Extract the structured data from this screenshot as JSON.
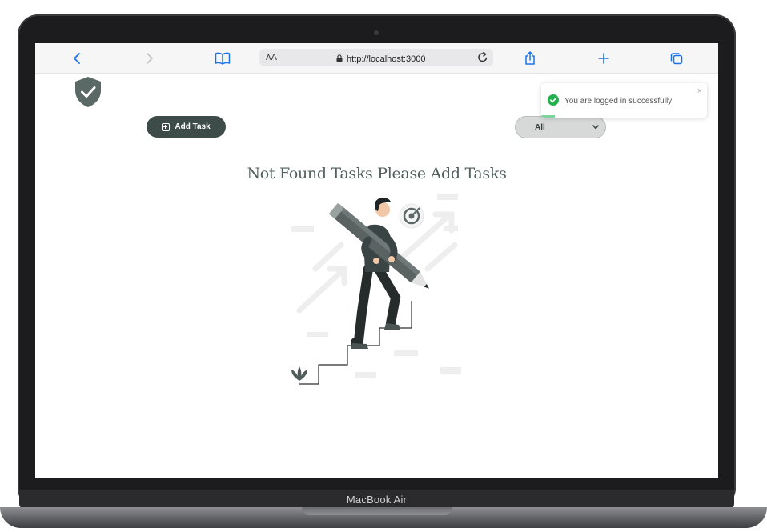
{
  "device": {
    "label": "MacBook Air"
  },
  "browser": {
    "url": "http://localhost:3000",
    "reader_label_small": "A",
    "reader_label_large": "A"
  },
  "app": {
    "add_task_label": "Add Task",
    "filter": {
      "selected": "All"
    },
    "empty_title": "Not Found Tasks Please Add Tasks"
  },
  "toast": {
    "message": "You are logged in successfully",
    "close_symbol": "×",
    "progress": 0.08
  },
  "colors": {
    "primary": "#3d4b49",
    "shield": "#5a6866",
    "toast_success": "#22b14c",
    "browser_blue": "#1a73e8"
  },
  "icons": {
    "back": "chevron-left-icon",
    "forward": "chevron-right-icon",
    "bookmarks": "book-icon",
    "lock": "lock-icon",
    "reload": "reload-icon",
    "share": "share-icon",
    "new_tab": "plus-icon",
    "tabs": "tabs-icon",
    "logo": "shield-check-icon",
    "success": "check-circle-icon"
  }
}
